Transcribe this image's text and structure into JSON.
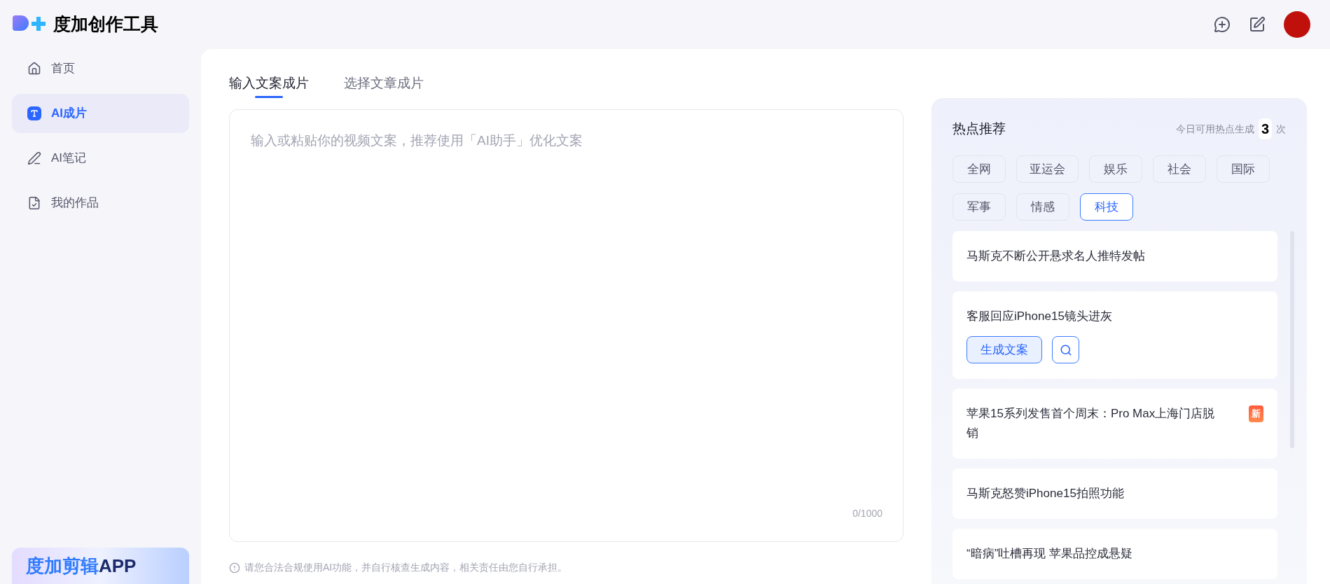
{
  "logo": {
    "title": "度加创作工具"
  },
  "sidebar": {
    "items": [
      {
        "label": "首页",
        "kind": "home",
        "selected": false
      },
      {
        "label": "AI成片",
        "kind": "text",
        "selected": true
      },
      {
        "label": "AI笔记",
        "kind": "note",
        "selected": false
      },
      {
        "label": "我的作品",
        "kind": "works",
        "selected": false
      }
    ],
    "promo": {
      "title_part1": "度加剪辑",
      "title_part2": "APP"
    }
  },
  "tabs": [
    {
      "label": "输入文案成片",
      "selected": true
    },
    {
      "label": "选择文章成片",
      "selected": false
    }
  ],
  "editor": {
    "placeholder": "输入或粘贴你的视频文案，推荐使用「AI助手」优化文案",
    "counter": "0/1000"
  },
  "notice": "请您合法合规使用AI功能，并自行核查生成内容，相关责任由您自行承担。",
  "hot": {
    "title": "热点推荐",
    "quota_label": "今日可用热点生成",
    "quota_count": "3",
    "quota_unit": "次",
    "categories": [
      {
        "label": "全网",
        "selected": false
      },
      {
        "label": "亚运会",
        "selected": false
      },
      {
        "label": "娱乐",
        "selected": false
      },
      {
        "label": "社会",
        "selected": false
      },
      {
        "label": "国际",
        "selected": false
      },
      {
        "label": "军事",
        "selected": false
      },
      {
        "label": "情感",
        "selected": false
      },
      {
        "label": "科技",
        "selected": true
      }
    ],
    "items": [
      {
        "title": "马斯克不断公开悬求名人推特发帖",
        "expanded": false
      },
      {
        "title": "客服回应iPhone15镜头进灰",
        "expanded": true,
        "action": "生成文案"
      },
      {
        "title": "苹果15系列发售首个周末：Pro Max上海门店脱销",
        "expanded": false,
        "badge": "新"
      },
      {
        "title": "马斯克怒赞iPhone15拍照功能",
        "expanded": false
      },
      {
        "title": "“暗病”吐槽再现 苹果品控成悬疑",
        "expanded": false
      }
    ]
  }
}
